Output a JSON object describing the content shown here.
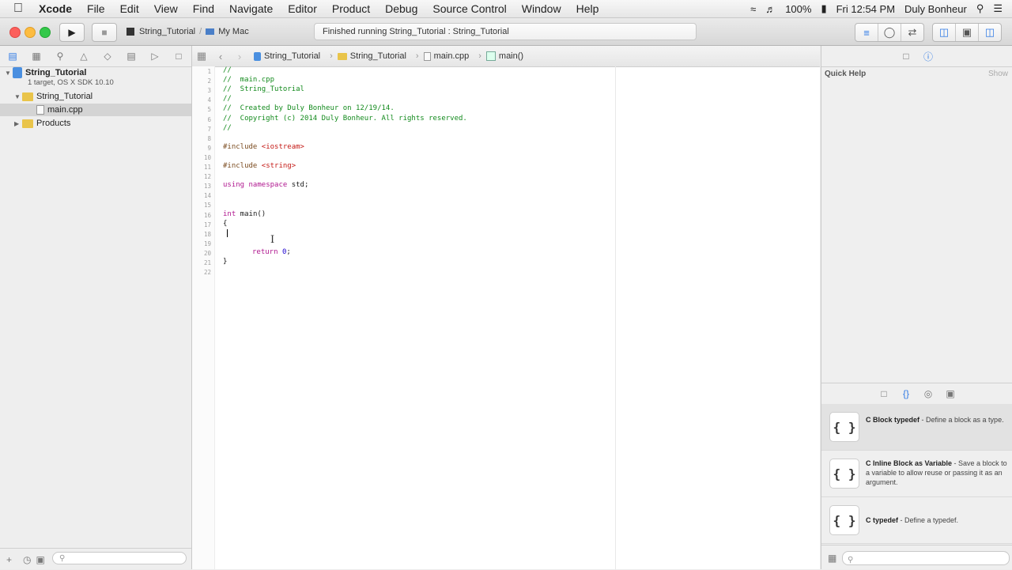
{
  "menubar": {
    "app": "Xcode",
    "items": [
      "File",
      "Edit",
      "View",
      "Find",
      "Navigate",
      "Editor",
      "Product",
      "Debug",
      "Source Control",
      "Window",
      "Help"
    ],
    "battery": "100%",
    "clock": "Fri 12:54 PM",
    "user": "Duly Bonheur"
  },
  "toolbar": {
    "scheme": "String_Tutorial",
    "destination": "My Mac",
    "status": "Finished running String_Tutorial : String_Tutorial"
  },
  "navigator": {
    "project_name": "String_Tutorial",
    "project_subtitle": "1 target, OS X SDK 10.10",
    "group": "String_Tutorial",
    "file": "main.cpp",
    "products": "Products"
  },
  "jumpbar": {
    "project": "String_Tutorial",
    "group": "String_Tutorial",
    "file": "main.cpp",
    "symbol": "main()"
  },
  "code": {
    "line_numbers": [
      "1",
      "2",
      "3",
      "4",
      "5",
      "6",
      "7",
      "8",
      "9",
      "10",
      "11",
      "12",
      "13",
      "14",
      "15",
      "16",
      "17",
      "18",
      "19",
      "20",
      "21",
      "22"
    ],
    "l1": "//",
    "l2": "//  main.cpp",
    "l3": "//  String_Tutorial",
    "l4": "//",
    "l5": "//  Created by Duly Bonheur on 12/19/14.",
    "l6": "//  Copyright (c) 2014 Duly Bonheur. All rights reserved.",
    "l7": "//",
    "l9_directive": "#include ",
    "l9_header": "<iostream>",
    "l11_directive": "#include ",
    "l11_header": "<string>",
    "l13_kw1": "using",
    "l13_kw2": "namespace",
    "l13_rest": " std;",
    "l16_kw": "int",
    "l16_rest": " main()",
    "l17": "{",
    "l20_kw": "return",
    "l20_num": "0",
    "l20_semicolon": ";",
    "l21": "}"
  },
  "utilities": {
    "quick_help": "Quick Help",
    "show": "Show",
    "snippets": [
      {
        "icon": "{ }",
        "title": "C Block typedef",
        "desc": " - Define a block as a type."
      },
      {
        "icon": "{ }",
        "title": "C Inline Block as Variable",
        "desc": " - Save a block to a variable to allow reuse or passing it as an argument."
      },
      {
        "icon": "{ }",
        "title": "C typedef",
        "desc": " - Define a typedef."
      }
    ]
  }
}
